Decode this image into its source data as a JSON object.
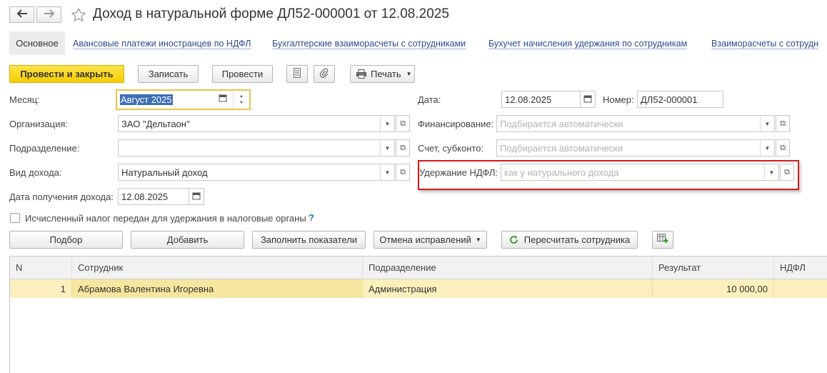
{
  "window": {
    "title": "Доход в натуральной форме ДЛ52-000001 от 12.08.2025"
  },
  "tabs": {
    "main": "Основное",
    "links": [
      "Авансовые платежи иностранцев по НДФЛ",
      "Бухгалтерские взаиморасчеты с сотрудниками",
      "Бухучет начисления удержания по сотрудникам",
      "Взаиморасчеты с сотрудн"
    ]
  },
  "toolbar": {
    "post_close": "Провести и закрыть",
    "save": "Записать",
    "post": "Провести",
    "print": "Печать"
  },
  "form": {
    "month_label": "Месяц:",
    "month_value": "Август 2025",
    "org_label": "Организация:",
    "org_value": "ЗАО \"Дельтаон\"",
    "dept_label": "Подразделение:",
    "dept_value": "",
    "income_type_label": "Вид дохода:",
    "income_type_value": "Натуральный доход",
    "income_date_label": "Дата получения дохода:",
    "income_date_value": "12.08.2025",
    "date_label": "Дата:",
    "date_value": "12.08.2025",
    "number_label": "Номер:",
    "number_value": "ДЛ52-000001",
    "financing_label": "Финансирование:",
    "financing_placeholder": "Подбирается автоматически",
    "account_label": "Счет, субконто:",
    "account_placeholder": "Подбирается автоматически",
    "ndfl_label": "Удержание НДФЛ:",
    "ndfl_placeholder": "как у натурального дохода",
    "tax_checkbox_label": "Исчисленный налог передан для удержания в налоговые органы",
    "help": "?"
  },
  "table_toolbar": {
    "pick": "Подбор",
    "add": "Добавить",
    "fill": "Заполнить показатели",
    "cancel_fix": "Отмена исправлений",
    "recalc": "Пересчитать сотрудника"
  },
  "table": {
    "columns": [
      "N",
      "Сотрудник",
      "Подразделение",
      "Результат",
      "НДФЛ"
    ],
    "rows": [
      {
        "n": "1",
        "employee": "Абрамова Валентина Игоревна",
        "dept": "Администрация",
        "result": "10 000,00",
        "ndfl": ""
      }
    ]
  },
  "colors": {
    "primary_button": "#f6cd00",
    "link": "#2c4b8f",
    "selected_row": "#fbf0bd",
    "highlight_border": "#d21b1b",
    "focus_border": "#f0c24b"
  },
  "icons": [
    "arrow-left-icon",
    "arrow-right-icon",
    "star-icon",
    "list-icon",
    "paperclip-icon",
    "printer-icon",
    "calendar-icon",
    "refresh-icon",
    "table-add-icon"
  ]
}
